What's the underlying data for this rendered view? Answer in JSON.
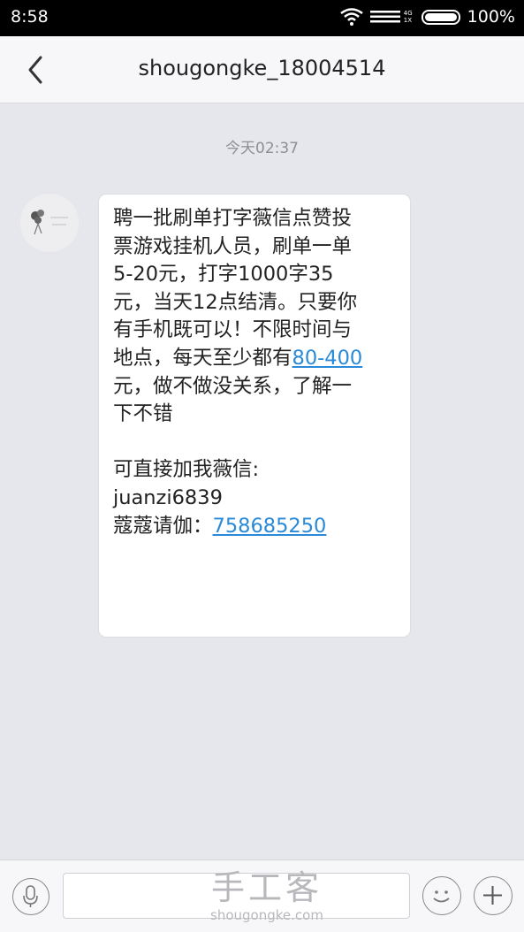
{
  "status_bar": {
    "time": "8:58",
    "net_top": "4G",
    "net_bottom": "1X",
    "battery": "100%"
  },
  "header": {
    "title": "shougongke_18004514"
  },
  "chat": {
    "timestamp": "今天02:37",
    "message": {
      "lines": [
        "聘一批刷单打字薇信点赞投",
        "票游戏挂机人员，刷单一单",
        "5-20元，打字1000字35",
        "元，当天12点结清。只要你",
        "有手机既可以！不限时间与"
      ],
      "line6_prefix": "地点，每天至少都有",
      "line6_link": "80-400",
      "line7": "元，做不做没关系，了解一",
      "line8": "下不错",
      "contact_intro": "可直接加我薇信:",
      "contact_id": "juanzi6839",
      "qq_prefix": "蔻蔻请伽：",
      "qq_link": "758685250"
    }
  },
  "watermark": {
    "main": "手工客",
    "sub": "shougongke.com"
  },
  "colors": {
    "link": "#2a8ad8",
    "background": "#e6e7ec",
    "bubble": "#ffffff"
  },
  "icons": [
    "wifi-icon",
    "signal-icon",
    "battery-icon",
    "back-arrow-icon",
    "mic-icon",
    "emoji-icon",
    "plus-icon"
  ]
}
